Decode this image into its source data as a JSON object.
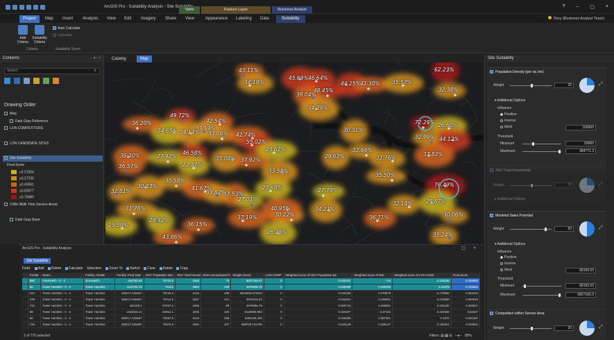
{
  "app": {
    "title": "ArcGIS Pro - Suitability Analysis - Site Suitability",
    "user": "Tony (Business Analyst Team)",
    "window_controls": [
      "?",
      "–",
      "▢",
      "×"
    ]
  },
  "context_tabs": {
    "table": "Table",
    "feature_layer": "Feature Layer",
    "business_analyst": "Business Analyst"
  },
  "tabs": [
    "Project",
    "Map",
    "Insert",
    "Analysis",
    "View",
    "Edit",
    "Imagery",
    "Share",
    "View",
    "Appearance",
    "Labeling",
    "Data",
    "Suitability"
  ],
  "ribbon": {
    "add_criteria": "Add Criteria",
    "suitability_criteria": "Suitability Criteria",
    "auto_calculate": "Auto Calculate",
    "calculate": "Calculate",
    "group_criteria": "Criteria",
    "group_score": "Suitability Score"
  },
  "contents": {
    "title": "Contents",
    "search_placeholder": "Search",
    "drawing_order": "Drawing Order",
    "layers": {
      "map": "Map",
      "dark_gray_reference": "Dark Gray Reference",
      "lon_competitors": "LON COMPETITORS",
      "lon_candidate_sites": "LON CANDIDATE SITES",
      "site_suitability": "Site Suitability",
      "final_score": "Final Score",
      "walk_time": "3 Min Walk Time Service Areas",
      "dark_gray_base": "Dark Gray Base"
    },
    "legend": [
      {
        "label": "≤0.21554",
        "color": "#c9b21f"
      },
      {
        "label": "≤0.27235",
        "color": "#c98f1c"
      },
      {
        "label": "≤0.40061",
        "color": "#c9641e"
      },
      {
        "label": "≤0.55877",
        "color": "#c23b1c"
      },
      {
        "label": "≤0.78489",
        "color": "#a01414"
      }
    ]
  },
  "map_tabs": {
    "catalog": "Catalog",
    "map": "Map"
  },
  "map_labels": [
    "43.11%",
    "46.64%",
    "45.69%",
    "48.45%",
    "39.04%",
    "44.25%",
    "41.30%",
    "35.57%",
    "62.23%",
    "32.38%",
    "34.19%",
    "34.29%",
    "49.72%",
    "42.54%",
    "24.65%",
    "36.20%",
    "33.59%",
    "34.14%",
    "33.06%",
    "42.74%",
    "30.31%",
    "72.29%",
    "26.60%",
    "44.12%",
    "32.99%",
    "55.02%",
    "36.30%",
    "27.92%",
    "46.58%",
    "35.08%",
    "37.92%",
    "23.62%",
    "29.62%",
    "33.66%",
    "31.76%",
    "37.82%",
    "36.57%",
    "22.37%",
    "33.58%",
    "35.50%",
    "32.81%",
    "30.33%",
    "30.58%",
    "41.67%",
    "37.53%",
    "27.79%",
    "25.68%",
    "76.49%",
    "27.01%",
    "32.14%",
    "25.87%",
    "31.76%",
    "33.82%",
    "34.21%",
    "30.22%",
    "37.19%",
    "26.92%",
    "36.15%",
    "25.39%",
    "40.95%",
    "30.06%",
    "36.71%",
    "26.25%",
    "43.86%",
    "35.24%"
  ],
  "suitability": {
    "title": "Site Suitability",
    "criteria": [
      {
        "name": "Population Density (per sq. km)",
        "weight_label": "Weight",
        "weight": "25",
        "additional_options": "Additional Options",
        "influence": "Influence",
        "positive": "Positive",
        "inverse": "Inverse",
        "ideal": "Ideal",
        "ideal_value": "100000",
        "threshold": "Threshold",
        "minimum": "Minimum",
        "min_value": "50000",
        "maximum": "Maximum",
        "max_value": "284771.3"
      },
      {
        "name": "2017 Total Households",
        "weight_label": "Weight",
        "weight": "25",
        "additional_options": "Additional Options"
      },
      {
        "name": "Modeled Sales Potential",
        "weight_label": "Weight",
        "weight": "50",
        "additional_options": "Additional Options",
        "influence": "Influence",
        "positive": "Positive",
        "inverse": "Inverse",
        "ideal": "Ideal",
        "ideal_value": "68165.55",
        "threshold": "Threshold",
        "minimum": "Minimum",
        "min_value": "68165.55",
        "maximum": "Maximum",
        "max_value": "6827165.0"
      },
      {
        "name": "Competition within Service Area",
        "weight_label": "Weight",
        "weight": "25"
      }
    ]
  },
  "analysis": {
    "title": "ArcGIS Pro - Suitability Analysis",
    "tab": "Site Suitability",
    "toolbar": [
      "Field:",
      "Add",
      "Delete",
      "Calculate",
      "Selection:",
      "Zoom To",
      "Switch",
      "Clear",
      "Delete",
      "Copy"
    ],
    "columns": [
      "",
      "FacilitI",
      "Name",
      "Facility: NAME",
      "Facility: Pred Sale",
      "2017 Population Den",
      "2017 Total Househ",
      "2016 Unemployed Pop",
      "Weight (Sum)",
      "LON COMP",
      "Weighted score of 2017 Population De",
      "Weighted score of Wai",
      "Weighted score of LON COMI",
      "Final Score"
    ],
    "rows": [
      [
        "",
        "890",
        "Greenwich : 0 - 3",
        "Greenwich",
        "444755.52",
        "75724.8",
        "1918",
        "73",
        "6827165.07",
        "0",
        "0.030322",
        "0.5",
        "0.226160",
        "0.784893"
      ],
      [
        "",
        "92",
        "Tower Hamlets : 0 - 3",
        "Tower Hamlets",
        "1114725.75",
        "75421",
        "2862",
        "226",
        "4879008.79",
        "0",
        "0.039988",
        "0.339193",
        "0.21975",
        "0.722841"
      ],
      [
        "",
        "244",
        "Tower Hamlets : 0 - 3",
        "Tower Hamlets",
        "189217.546667",
        "78126.2",
        "2145",
        "298",
        "3524685.673533",
        "0",
        "0.043198",
        "0.470679",
        "0.179868",
        "0.693263"
      ],
      [
        "",
        "239",
        "Tower Hamlets : 0 - 3",
        "Tower Hamlets",
        "189217.546667",
        "79414.6",
        "2027",
        "231",
        "3979216.22",
        "0",
        "0.043391",
        "0.430081",
        "0.210908",
        "0.684029"
      ],
      [
        "",
        "712",
        "Tower Hamlets : 0 - 3",
        "Tower Hamlets",
        "463108.1",
        "67837.2",
        "1558",
        "99",
        "4679085.79",
        "0",
        "0.028715",
        "0.338081",
        "0.242180",
        "0.628521"
      ],
      [
        "",
        "98",
        "Tower Hamlets : 0 - 3",
        "Tower Hamlets",
        "1453916.14",
        "84812.1",
        "1605",
        "106",
        "5160995.903",
        "0",
        "0.024487",
        "0.37162",
        "0.229365",
        "0.62227"
      ],
      [
        "",
        "66",
        "Tower Hamlets : 0 - 3",
        "Tower Hamlets",
        "189217.546667",
        "79087.9",
        "2143",
        "298",
        "5381106.428",
        "0",
        "0.045386",
        "0.387301",
        "0.1875",
        "0.620187"
      ],
      [
        "",
        "726",
        "Tower Hamlets : 0 - 3",
        "Tower Hamlets",
        "189217.546667",
        "78376.8",
        "1594",
        "107",
        "6587067.51789",
        "0",
        "0.043148",
        "0.285147",
        "0.195321",
        "0.618931"
      ]
    ],
    "status": "2 of 770 selected",
    "filters": "Filters:",
    "zoom": "85%"
  }
}
